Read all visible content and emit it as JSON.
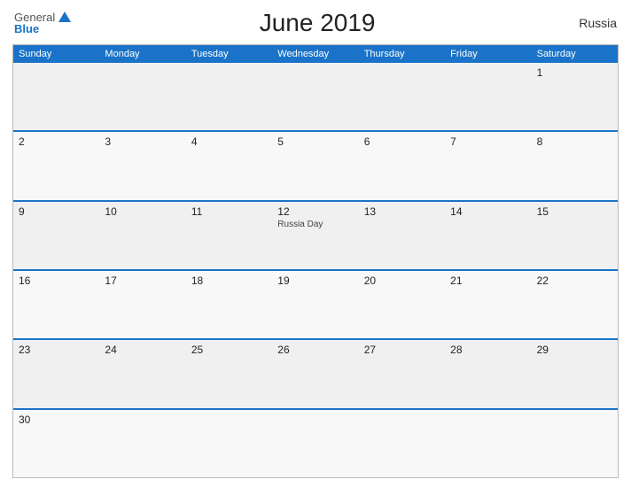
{
  "header": {
    "title": "June 2019",
    "country": "Russia",
    "logo_general": "General",
    "logo_blue": "Blue"
  },
  "calendar": {
    "day_headers": [
      "Sunday",
      "Monday",
      "Tuesday",
      "Wednesday",
      "Thursday",
      "Friday",
      "Saturday"
    ],
    "weeks": [
      [
        {
          "day": "",
          "empty": true
        },
        {
          "day": "",
          "empty": true
        },
        {
          "day": "",
          "empty": true
        },
        {
          "day": "",
          "empty": true
        },
        {
          "day": "",
          "empty": true
        },
        {
          "day": "",
          "empty": true
        },
        {
          "day": "1",
          "event": ""
        }
      ],
      [
        {
          "day": "2",
          "event": ""
        },
        {
          "day": "3",
          "event": ""
        },
        {
          "day": "4",
          "event": ""
        },
        {
          "day": "5",
          "event": ""
        },
        {
          "day": "6",
          "event": ""
        },
        {
          "day": "7",
          "event": ""
        },
        {
          "day": "8",
          "event": ""
        }
      ],
      [
        {
          "day": "9",
          "event": ""
        },
        {
          "day": "10",
          "event": ""
        },
        {
          "day": "11",
          "event": ""
        },
        {
          "day": "12",
          "event": "Russia Day"
        },
        {
          "day": "13",
          "event": ""
        },
        {
          "day": "14",
          "event": ""
        },
        {
          "day": "15",
          "event": ""
        }
      ],
      [
        {
          "day": "16",
          "event": ""
        },
        {
          "day": "17",
          "event": ""
        },
        {
          "day": "18",
          "event": ""
        },
        {
          "day": "19",
          "event": ""
        },
        {
          "day": "20",
          "event": ""
        },
        {
          "day": "21",
          "event": ""
        },
        {
          "day": "22",
          "event": ""
        }
      ],
      [
        {
          "day": "23",
          "event": ""
        },
        {
          "day": "24",
          "event": ""
        },
        {
          "day": "25",
          "event": ""
        },
        {
          "day": "26",
          "event": ""
        },
        {
          "day": "27",
          "event": ""
        },
        {
          "day": "28",
          "event": ""
        },
        {
          "day": "29",
          "event": ""
        }
      ],
      [
        {
          "day": "30",
          "event": ""
        },
        {
          "day": "",
          "empty": true
        },
        {
          "day": "",
          "empty": true
        },
        {
          "day": "",
          "empty": true
        },
        {
          "day": "",
          "empty": true
        },
        {
          "day": "",
          "empty": true
        },
        {
          "day": "",
          "empty": true
        }
      ]
    ]
  }
}
